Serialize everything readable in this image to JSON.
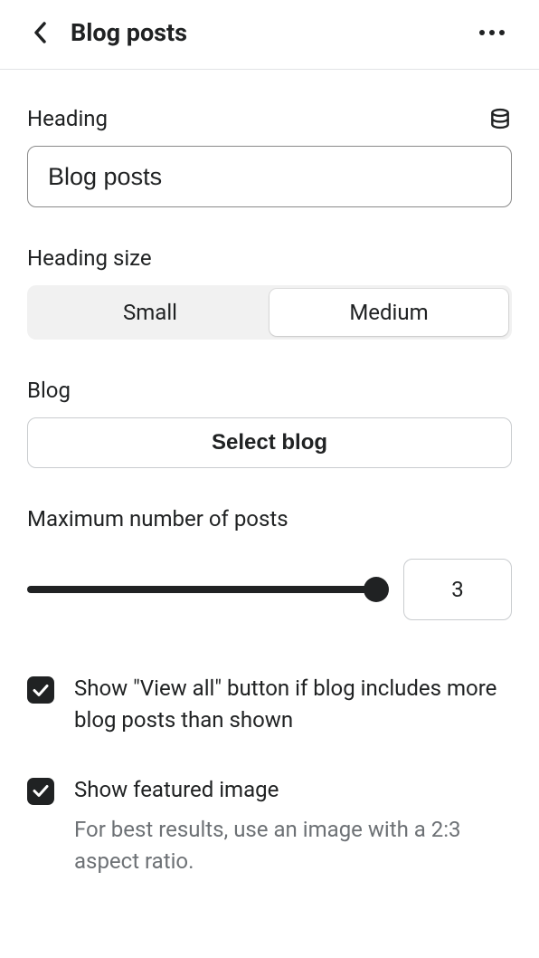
{
  "header": {
    "title": "Blog posts"
  },
  "heading_field": {
    "label": "Heading",
    "value": "Blog posts"
  },
  "heading_size": {
    "label": "Heading size",
    "options": [
      "Small",
      "Medium"
    ],
    "selected": "Medium"
  },
  "blog": {
    "label": "Blog",
    "button_label": "Select blog"
  },
  "max_posts": {
    "label": "Maximum number of posts",
    "value": "3"
  },
  "show_view_all": {
    "checked": true,
    "label": "Show \"View all\" button if blog includes more blog posts than shown"
  },
  "show_featured_image": {
    "checked": true,
    "label": "Show featured image",
    "helper": "For best results, use an image with a 2:3 aspect ratio."
  }
}
